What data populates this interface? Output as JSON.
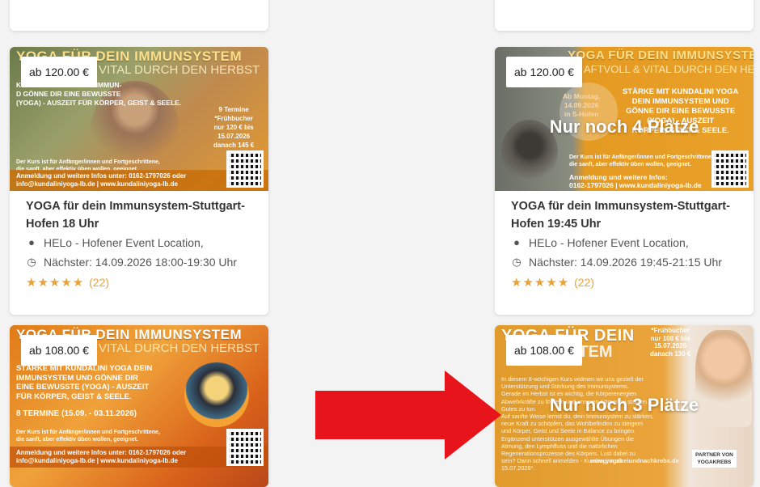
{
  "cards": [
    {
      "price": "ab 120.00 €",
      "banner": "YOGA FÜR DEIN IMMUNSYSTEM",
      "banner_sub": "VITAL DURCH DEN HERBST",
      "img_text": "KUNDALINI YOGA DEIN IMMUN-\nD GÖNNE DIR EINE BEWUSSTE\n(YOGA) - AUSZEIT FÜR KÖRPER, GEIST & SEELE.",
      "side_text": "9 Termine\n*Frühbucher\nnur 120 € bis\n15.07.2026\ndanach 145 €",
      "foot": "Anmeldung und weitere Infos unter: 0162-1797026 oder\ninfo@kundaliniyoga-lb.de | www.kundaliniyoga-lb.de",
      "note": "Der Kurs ist für Anfänger/innen und Fortgeschrittene,\ndie sanft, aber effektiv üben wollen, geeignet.",
      "overlay": "",
      "title": "YOGA für dein Immunsystem-Stuttgart-Hofen 18 Uhr",
      "location": "HELo - Hofener Event Location,",
      "next": "Nächster: 14.09.2026 18:00-19:30 Uhr",
      "rating_count": "(22)"
    },
    {
      "price": "ab 120.00 €",
      "banner": "YOGA FÜR DEIN IMMUNSYSTEM",
      "banner_sub": "AFTVOLL & VITAL DURCH DEN HERBST",
      "img_text": "STÄRKE MIT KUNDALINI YOGA\nDEIN IMMUNSYSTEM UND\nGÖNNE DIR EINE BEWUSSTE\n(YOGA) - AUSZEIT\nKÖRPER, GEIST & SEELE.",
      "side_text": "Ab Montag,\n14.09.2026\nin S-Hofen",
      "foot": "Anmeldung und weitere Infos:\n0162-1797026 | www.kundaliniyoga-lb.de",
      "note": "Der Kurs ist für Anfänger/innen und Fortgeschrittene,\ndie sanft, aber effektiv üben wollen, geeignet.",
      "overlay": "Nur noch 4 Plätze",
      "title": "YOGA für dein Immunsystem-Stuttgart-Hofen 19:45 Uhr",
      "location": "HELo - Hofener Event Location,",
      "next": "Nächster: 14.09.2026 19:45-21:15 Uhr",
      "rating_count": "(22)"
    },
    {
      "price": "ab 108.00 €",
      "banner": "YOGA FÜR DEIN IMMUNSYSTEM",
      "banner_sub": "VITAL DURCH DEN HERBST",
      "img_text": "STÄRKE MIT KUNDALINI YOGA DEIN\nIMMUNSYSTEM UND GÖNNE DIR\nEINE BEWUSSTE (YOGA) - AUSZEIT\nFÜR KÖRPER, GEIST & SEELE.",
      "side_text": "8 TERMINE (15.09. - 03.11.2026)",
      "foot": "Anmeldung und weitere Infos unter: 0162-1797026 oder\ninfo@kundaliniyoga-lb.de | www.kundaliniyoga-lb.de",
      "note": "Der Kurs ist für Anfänger/innen und Fortgeschrittene,\ndie sanft, aber effektiv üben wollen, geeignet.",
      "overlay": ""
    },
    {
      "price": "ab 108.00 €",
      "banner": "YOGA FÜR DEIN",
      "banner_sub": "STEM",
      "img_text": "In diesem 8-wöchigen Kurs widmen wir uns gezielt der\nUnterstützung und Stärkung des Immunsystems.\nGerade im Herbst ist es wichtig, die Körperenergien\nAbwehrkräfte zu fördern und unseren Körper zu stärken.\nGutes zu tun.\nAuf sanfte Weise lernst du, dein Immunsystem zu stärken,\nneue Kraft zu schöpfen, das Wohlbefinden zu steigern\nund Körper, Geist und Seele in Balance zu bringen.\nErgänzend unterstützen ausgewählte Übungen die\nAtmung, den Lymphfluss und die natürlichen\nRegenerationsprozesse des Körpers. Lust dabei zu\nsein? Dann schnell anmelden - Kursbeginn ab\n15.07.2026*.",
      "side_text": "*Frühbucher\nnur 108 € bis\n15.07.2026\ndanach 130 €",
      "foot": "www.yogabeiundnachkrebs.de",
      "note": "PARTNER VON\nYOGAKREBS",
      "overlay": "Nur noch 3 Plätze"
    }
  ],
  "colors": {
    "accent": "#e8a23a",
    "arrow": "#e8141b"
  }
}
